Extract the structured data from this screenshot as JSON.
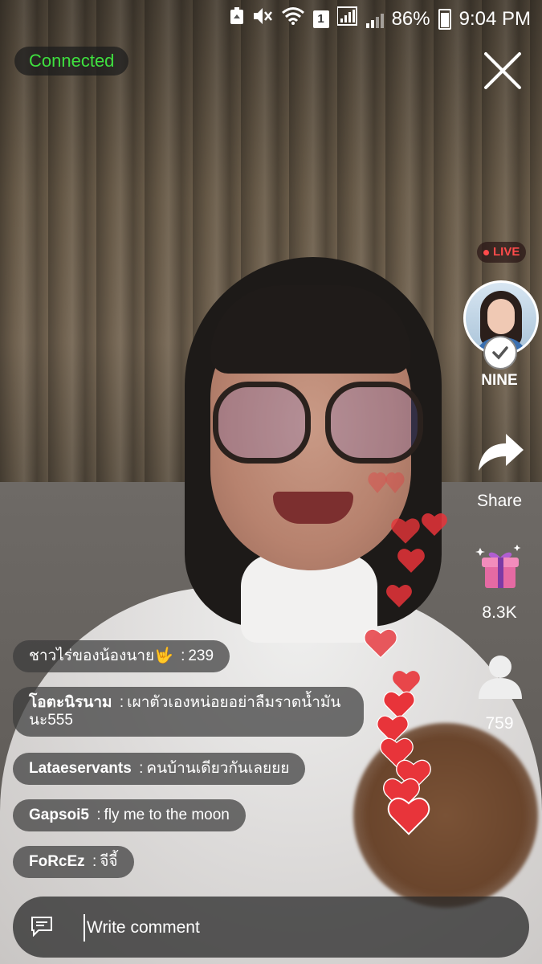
{
  "status_bar": {
    "battery": "86%",
    "time": "9:04 PM",
    "sim_slot": "1"
  },
  "stream": {
    "connection_status": "Connected",
    "live_label": "LIVE",
    "host_name": "NINE"
  },
  "rail": {
    "share_label": "Share",
    "gift_count": "8.3K",
    "viewer_count": "759"
  },
  "comments": [
    {
      "user": "ชาวไร่ของน้องนาย🤟",
      "text": "239"
    },
    {
      "user": "โอตะนิรนาม",
      "text": "เผาตัวเองหน่อยอย่าลืมราดน้ำมัน",
      "text2": "นะ555"
    },
    {
      "user": "Lataeservants",
      "text": "คนบ้านเดียวกันเลยยย"
    },
    {
      "user": "Gapsoi5",
      "text": "fly me to the moon"
    },
    {
      "user": "FoRcEz",
      "text": "จีจี้"
    }
  ],
  "comment_input": {
    "placeholder": "Write comment"
  },
  "colors": {
    "connected": "#3fe03f",
    "live": "#ff4b4b",
    "heart": "#e8343a"
  },
  "icons": [
    "recycle-icon",
    "mute-icon",
    "wifi-icon",
    "signal-icon",
    "battery-icon",
    "close-icon",
    "share-icon",
    "gift-icon",
    "viewer-icon",
    "chat-icon",
    "verified-icon",
    "heart-icon"
  ]
}
